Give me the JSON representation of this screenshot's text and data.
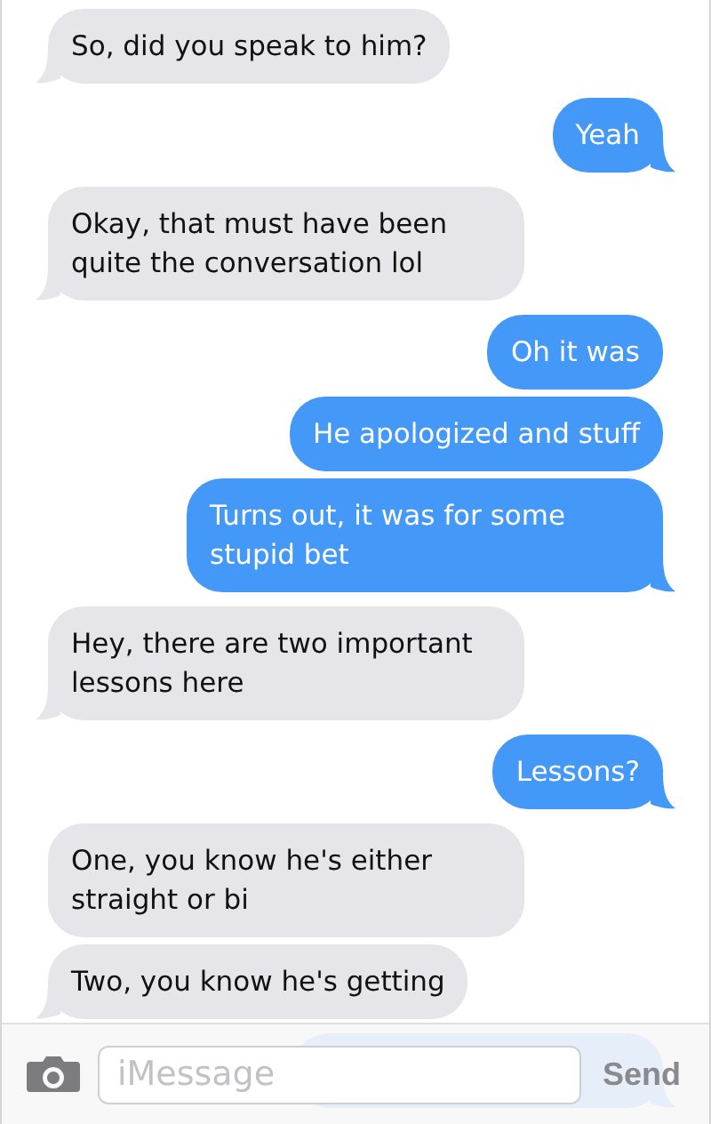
{
  "messages": [
    {
      "kind": "them",
      "text": "So, did you speak to him?"
    },
    {
      "kind": "me",
      "text": "Yeah"
    },
    {
      "kind": "them",
      "text": "Okay, that must have been quite the conversation lol"
    },
    {
      "kind": "me",
      "text": "Oh it was"
    },
    {
      "kind": "me",
      "text": "He apologized and stuff"
    },
    {
      "kind": "me",
      "text": "Turns out, it was for some stupid bet"
    },
    {
      "kind": "them",
      "text": "Hey, there are two important lessons here"
    },
    {
      "kind": "me",
      "text": "Lessons?"
    },
    {
      "kind": "them",
      "text": "One, you know he's either straight or bi"
    },
    {
      "kind": "them",
      "text": "Two, you know he's getting"
    },
    {
      "kind": "me"
    }
  ],
  "composer": {
    "placeholder": "iMessage",
    "send_label": "Send"
  }
}
